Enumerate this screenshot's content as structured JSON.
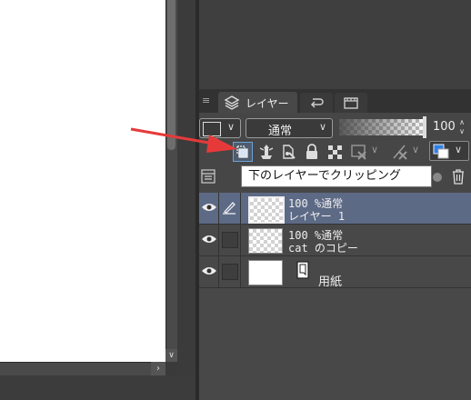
{
  "tabs": {
    "layer_label": "レイヤー"
  },
  "toolbar": {
    "blend_mode": "通常",
    "opacity_value": "100",
    "opacity_level": 1.0
  },
  "tooltip": {
    "text": "下のレイヤーでクリッピング"
  },
  "layers": [
    {
      "line1": "100 %通常",
      "line2": "レイヤー 1",
      "selected": true
    },
    {
      "line1": "100 %通常",
      "line2": "cat のコピー",
      "selected": false
    },
    {
      "name": "用紙"
    }
  ],
  "icons": [
    "layer-stack-icon",
    "undo-tab-icon",
    "film-tab-icon",
    "clip-to-below-icon",
    "reference-layer-icon",
    "draft-layer-icon",
    "lock-icon",
    "lock-transparent-icon",
    "mask-icon",
    "delete-mask-icon",
    "color-icon",
    "eye-icon",
    "pen-icon",
    "paper-icon",
    "trash-icon",
    "camera-icon"
  ],
  "colors": {
    "selected_row": "#5d6a86",
    "arrow": "#e63a3a",
    "clip_highlight": "#6fa1d4",
    "color_chip_blue": "#2f7fe6"
  }
}
